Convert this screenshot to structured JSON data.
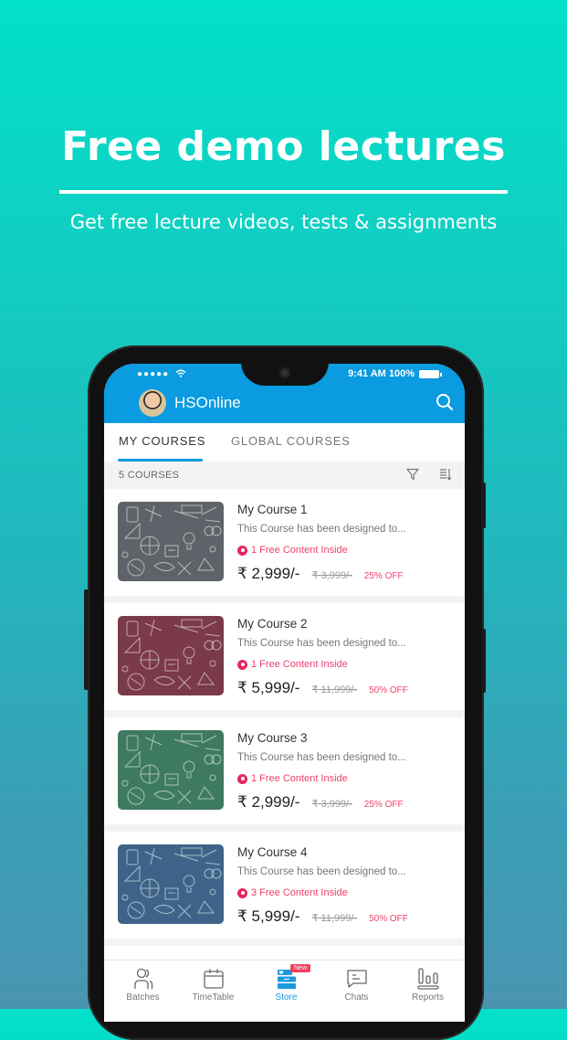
{
  "hero": {
    "title": "Free demo lectures",
    "subtitle": "Get free lecture videos, tests & assignments"
  },
  "status_bar": {
    "signal": "●●●●●",
    "time": "9:41 AM",
    "battery": "100%"
  },
  "app_bar": {
    "title": "HSOnline",
    "search_icon": "search-icon"
  },
  "tabs": [
    {
      "label": "MY COURSES",
      "active": true
    },
    {
      "label": "GLOBAL COURSES",
      "active": false
    }
  ],
  "filter_bar": {
    "count_label": "5 COURSES",
    "filter_icon": "filter-icon",
    "sort_icon": "sort-icon"
  },
  "courses": [
    {
      "title": "My Course 1",
      "description": "This Course has been designed to...",
      "free_content": "1 Free Content Inside",
      "price": "₹ 2,999/-",
      "original_price": "₹ 3,999/-",
      "discount": "25% OFF",
      "thumb_color": "#5d6368"
    },
    {
      "title": "My Course 2",
      "description": "This Course has been designed to...",
      "free_content": "1 Free Content Inside",
      "price": "₹ 5,999/-",
      "original_price": "₹ 11,999/-",
      "discount": "50% OFF",
      "thumb_color": "#7a3a4a"
    },
    {
      "title": "My Course 3",
      "description": "This Course has been designed to...",
      "free_content": "1 Free Content Inside",
      "price": "₹ 2,999/-",
      "original_price": "₹ 3,999/-",
      "discount": "25% OFF",
      "thumb_color": "#3e7a60"
    },
    {
      "title": "My Course 4",
      "description": "This Course has been designed to...",
      "free_content": "3 Free Content Inside",
      "price": "₹ 5,999/-",
      "original_price": "₹ 11,999/-",
      "discount": "50% OFF",
      "thumb_color": "#3d6488"
    }
  ],
  "bottom_nav": [
    {
      "label": "Batches",
      "icon": "batches-icon",
      "active": false
    },
    {
      "label": "TimeTable",
      "icon": "calendar-icon",
      "active": false
    },
    {
      "label": "Store",
      "icon": "store-icon",
      "active": true,
      "badge": "New"
    },
    {
      "label": "Chats",
      "icon": "chat-icon",
      "active": false
    },
    {
      "label": "Reports",
      "icon": "reports-icon",
      "active": false
    }
  ],
  "colors": {
    "primary": "#0a9be0",
    "accent_pink": "#f0416c",
    "badge_red": "#f0415e"
  }
}
